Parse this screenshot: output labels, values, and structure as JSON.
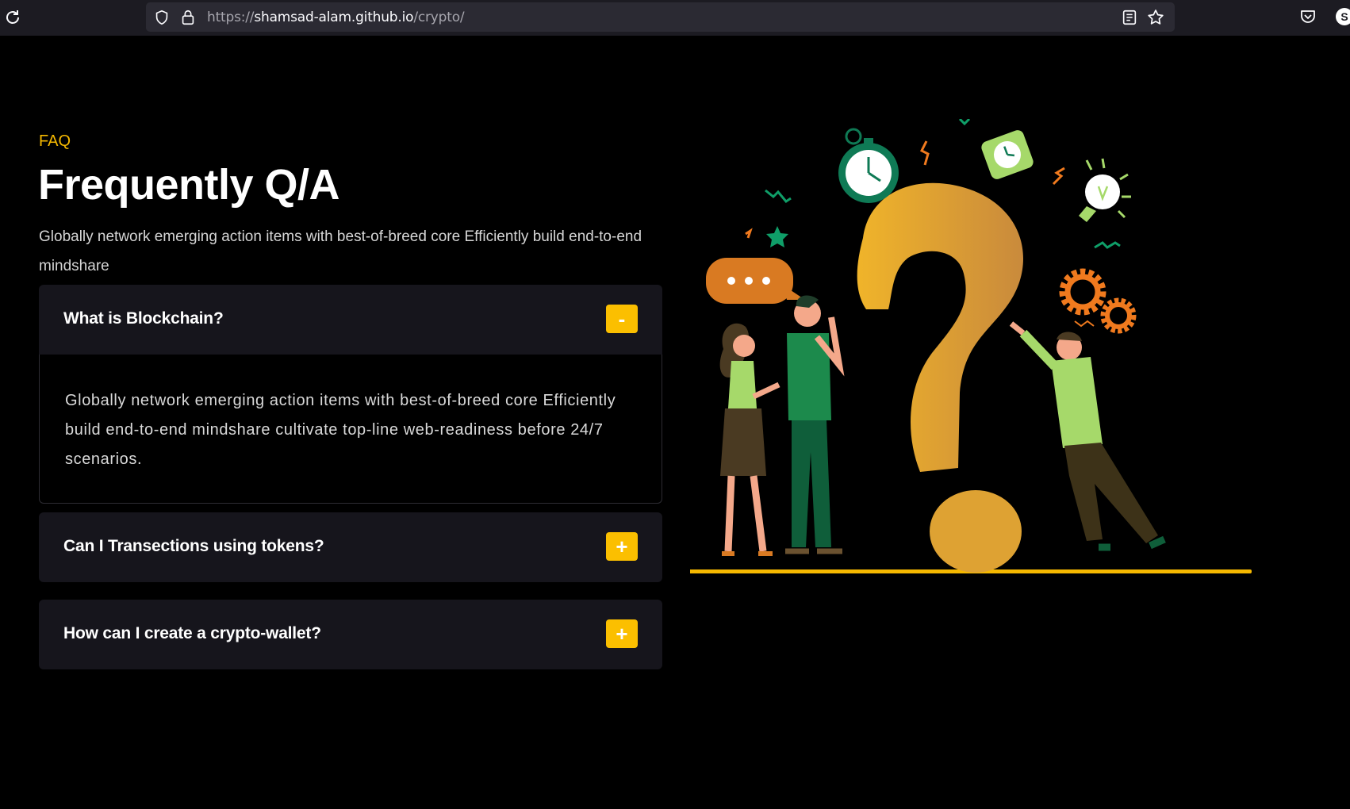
{
  "browser": {
    "url_prefix": "https://",
    "url_domain": "shamsad-alam.github.io",
    "url_path": "/crypto/",
    "account_initial": "S"
  },
  "faq_section": {
    "eyebrow": "FAQ",
    "title": "Frequently Q/A",
    "intro": "Globally network emerging action items with best-of-breed core Efficiently build end-to-end mindshare",
    "items": [
      {
        "question": "What is Blockchain?",
        "toggle": "-",
        "answer": "Globally network emerging action items with best-of-breed core Efficiently build end-to-end mindshare cultivate top-line web-readiness before 24/7 scenarios."
      },
      {
        "question": "Can I Transections using tokens?",
        "toggle": "+"
      },
      {
        "question": "How can I create a crypto-wallet?",
        "toggle": "+"
      }
    ]
  },
  "colors": {
    "accent": "#fbbf00",
    "background": "#000000",
    "card": "#16151c",
    "question_mark": "#e0a436",
    "green_dark": "#0f6b45",
    "green_light": "#a6d96a",
    "orange": "#f07a1e"
  },
  "icons": [
    "reload-icon",
    "shield-icon",
    "lock-icon",
    "reader-view-icon",
    "bookmark-star-icon",
    "pocket-icon"
  ]
}
